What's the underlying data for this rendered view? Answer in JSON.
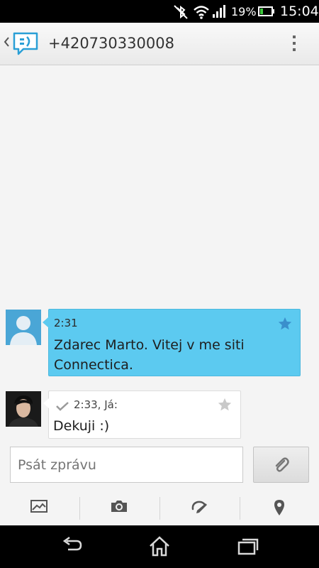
{
  "status_bar": {
    "battery_percent": "19%",
    "time": "15:04",
    "icons": [
      "bluetooth-off-icon",
      "wifi-icon",
      "signal-icon",
      "battery-icon"
    ]
  },
  "action_bar": {
    "title": "+420730330008",
    "icons": [
      "back-chevron-icon",
      "messaging-app-icon",
      "overflow-menu-icon"
    ]
  },
  "messages": [
    {
      "direction": "incoming",
      "time": "2:31",
      "text_lines": [
        "Zdarec Marto. Vitej v me siti",
        "Connectica."
      ],
      "starred": true,
      "bubble_color": "#5ccaf0"
    },
    {
      "direction": "outgoing",
      "time": "2:33, Já:",
      "text_lines": [
        "Dekuji :)"
      ],
      "starred": false,
      "delivered": true,
      "bubble_color": "#ffffff"
    }
  ],
  "composer": {
    "placeholder": "Psát zprávu",
    "attach_icon": "paperclip-icon"
  },
  "quick_actions": [
    "gallery-icon",
    "camera-icon",
    "draw-icon",
    "location-icon"
  ],
  "nav_bar": [
    "back-icon",
    "home-icon",
    "recent-apps-icon"
  ]
}
